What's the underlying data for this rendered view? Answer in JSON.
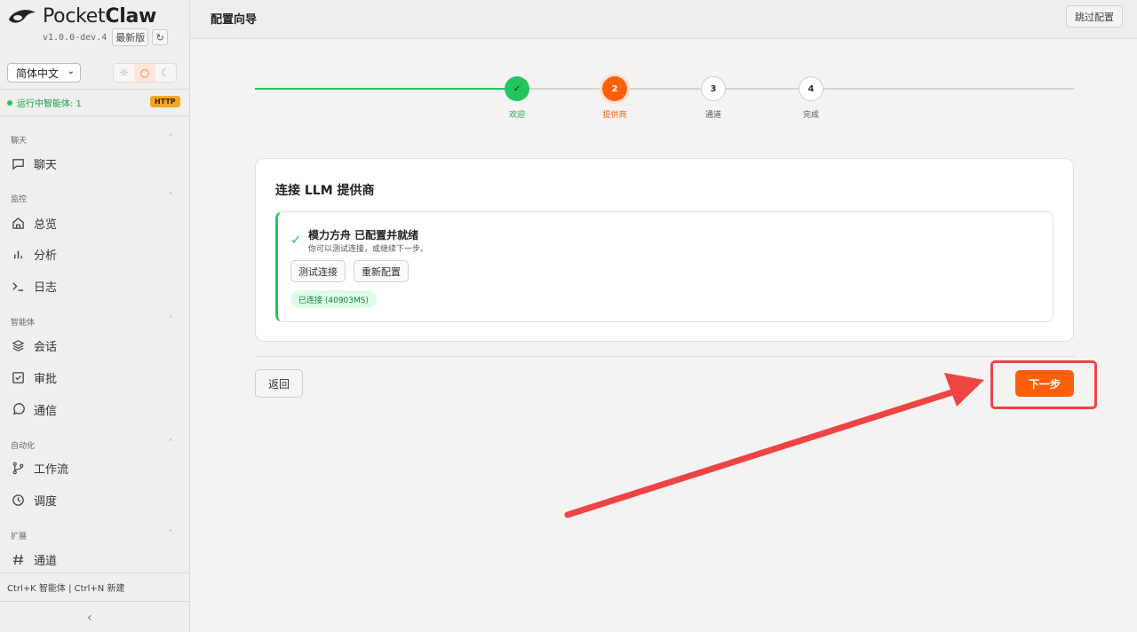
{
  "brand": {
    "name_light": "Pocket",
    "name_bold": "Claw",
    "version": "v1.0.0-dev.4",
    "latest_badge": "最新版",
    "refresh_icon": "↻"
  },
  "language": {
    "selected": "简体中文"
  },
  "theme": {
    "light_icon": "☼",
    "system_icon": "○",
    "dark_icon": "☾",
    "selected": "system"
  },
  "status": {
    "running_text": "运行中智能体: 1",
    "protocol_badge": "HTTP"
  },
  "sidebar": {
    "sections": [
      {
        "title": "聊天",
        "items": [
          {
            "label": "聊天",
            "icon": "chat-bubble-icon"
          }
        ]
      },
      {
        "title": "监控",
        "items": [
          {
            "label": "总览",
            "icon": "home-icon"
          },
          {
            "label": "分析",
            "icon": "bar-chart-icon"
          },
          {
            "label": "日志",
            "icon": "terminal-icon"
          }
        ]
      },
      {
        "title": "智能体",
        "items": [
          {
            "label": "会话",
            "icon": "layers-icon"
          },
          {
            "label": "审批",
            "icon": "checkbox-icon"
          },
          {
            "label": "通信",
            "icon": "message-circle-icon"
          }
        ]
      },
      {
        "title": "自动化",
        "items": [
          {
            "label": "工作流",
            "icon": "git-branch-icon"
          },
          {
            "label": "调度",
            "icon": "clock-icon"
          }
        ]
      },
      {
        "title": "扩展",
        "items": [
          {
            "label": "通道",
            "icon": "hash-icon"
          }
        ]
      }
    ],
    "shortcut_hint": "Ctrl+K 智能体 | Ctrl+N 新建",
    "collapse_icon": "‹"
  },
  "header": {
    "title": "配置向导",
    "skip_label": "跳过配置"
  },
  "stepper": {
    "steps": [
      {
        "marker": "✓",
        "label": "欢迎",
        "state": "done"
      },
      {
        "marker": "2",
        "label": "提供商",
        "state": "active"
      },
      {
        "marker": "3",
        "label": "通道",
        "state": "pending"
      },
      {
        "marker": "4",
        "label": "完成",
        "state": "pending"
      }
    ]
  },
  "card": {
    "title": "连接 LLM 提供商",
    "status_title": "模力方舟 已配置并就绪",
    "status_subtitle": "你可以测试连接，或继续下一步。",
    "test_button": "测试连接",
    "reconfigure_button": "重新配置",
    "connection_badge": "已连接 (40903MS)"
  },
  "footer": {
    "back_label": "返回",
    "next_label": "下一步"
  },
  "colors": {
    "accent": "#ff5f0a",
    "success": "#22c55e",
    "annotation": "#ef4444"
  }
}
